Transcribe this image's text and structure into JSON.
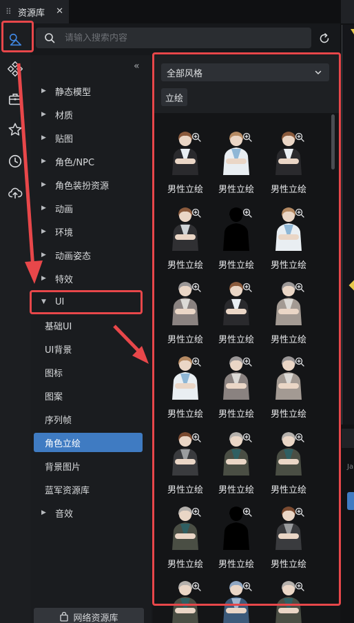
{
  "tab": {
    "title": "资源库",
    "grip": "⠿",
    "close": "✕"
  },
  "search": {
    "placeholder": "请输入搜索内容"
  },
  "rail": {
    "items": [
      "assets-icon",
      "components-icon",
      "toolbox-icon",
      "star-icon",
      "history-icon",
      "upload-icon"
    ]
  },
  "tree": {
    "collapse": "«",
    "categories": [
      {
        "label": "静态模型",
        "expanded": false
      },
      {
        "label": "材质",
        "expanded": false
      },
      {
        "label": "贴图",
        "expanded": false
      },
      {
        "label": "角色/NPC",
        "expanded": false
      },
      {
        "label": "角色装扮资源",
        "expanded": false
      },
      {
        "label": "动画",
        "expanded": false
      },
      {
        "label": "环境",
        "expanded": false
      },
      {
        "label": "动画姿态",
        "expanded": false
      },
      {
        "label": "特效",
        "expanded": false
      },
      {
        "label": "UI",
        "expanded": true
      }
    ],
    "ui_children": [
      "基础UI",
      "UI背景",
      "图标",
      "图案",
      "序列帧",
      "角色立绘",
      "背景图片",
      "蓝军资源库"
    ],
    "selected": "角色立绘",
    "after": {
      "label": "音效",
      "expanded": false
    },
    "network_button": "网络资源库"
  },
  "gallery": {
    "style_select": "全部风格",
    "tag": "立绘",
    "item_caption": "男性立绘",
    "items": [
      {
        "caption": "男性立绘",
        "hair": "#8a5a3c",
        "outfit": "#2a2a2d",
        "shirt": "#e9eef2",
        "variant": "normal"
      },
      {
        "caption": "男性立绘",
        "hair": "#b58a63",
        "outfit": "#e9eef2",
        "shirt": "#8fb7d6",
        "variant": "normal"
      },
      {
        "caption": "男性立绘",
        "hair": "#8a5a3c",
        "outfit": "#2a2a2d",
        "shirt": "#e9eef2",
        "variant": "normal"
      },
      {
        "caption": "男性立绘",
        "hair": "#8a5a3c",
        "outfit": "#303033",
        "shirt": "#cfd3d6",
        "variant": "normal"
      },
      {
        "caption": "男性立绘",
        "hair": "#000000",
        "outfit": "#000000",
        "shirt": "#000000",
        "variant": "silhouette"
      },
      {
        "caption": "男性立绘",
        "hair": "#b58a63",
        "outfit": "#e9eef2",
        "shirt": "#8fb7d6",
        "variant": "normal"
      },
      {
        "caption": "男性立绘",
        "hair": "#9a9696",
        "outfit": "#8a8280",
        "shirt": "#dcdad6",
        "variant": "normal"
      },
      {
        "caption": "男性立绘",
        "hair": "#8a5a3c",
        "outfit": "#2a2a2d",
        "shirt": "#e9eef2",
        "variant": "normal"
      },
      {
        "caption": "男性立绘",
        "hair": "#9a9696",
        "outfit": "#a39a93",
        "shirt": "#dcdad6",
        "variant": "normal"
      },
      {
        "caption": "男性立绘",
        "hair": "#b58a63",
        "outfit": "#e9eef2",
        "shirt": "#8fb7d6",
        "variant": "normal"
      },
      {
        "caption": "男性立绘",
        "hair": "#9a9696",
        "outfit": "#8a8280",
        "shirt": "#dcdad6",
        "variant": "normal"
      },
      {
        "caption": "男性立绘",
        "hair": "#9a9696",
        "outfit": "#a39a93",
        "shirt": "#dcdad6",
        "variant": "normal"
      },
      {
        "caption": "男性立绘",
        "hair": "#7a4a30",
        "outfit": "#3a3b3e",
        "shirt": "#9a9c9e",
        "variant": "normal"
      },
      {
        "caption": "男性立绘",
        "hair": "#b4b0ac",
        "outfit": "#4a4e44",
        "shirt": "#2f5f62",
        "variant": "normal"
      },
      {
        "caption": "男性立绘",
        "hair": "#b4b0ac",
        "outfit": "#4a4e44",
        "shirt": "#2f5f62",
        "variant": "normal"
      },
      {
        "caption": "男性立绘",
        "hair": "#b4b0ac",
        "outfit": "#4a4e44",
        "shirt": "#2f5f62",
        "variant": "normal"
      },
      {
        "caption": "男性立绘",
        "hair": "#000000",
        "outfit": "#000000",
        "shirt": "#000000",
        "variant": "silhouette"
      },
      {
        "caption": "男性立绘",
        "hair": "#7a4a30",
        "outfit": "#3a3b3e",
        "shirt": "#9a9c9e",
        "variant": "normal"
      },
      {
        "caption": "",
        "hair": "#b4b0ac",
        "outfit": "#4a4e44",
        "shirt": "#2f5f62",
        "variant": "normal"
      },
      {
        "caption": "",
        "hair": "#8fa6c2",
        "outfit": "#3c5a7a",
        "shirt": "#9fb6cf",
        "variant": "normal"
      },
      {
        "caption": "",
        "hair": "#b4b0ac",
        "outfit": "#4a4e44",
        "shirt": "#2f5f62",
        "variant": "normal"
      }
    ]
  },
  "right_panel": {
    "label": "Ja"
  },
  "colors": {
    "accent": "#3f7bc2",
    "annotation": "#e8474a",
    "warning": "#e6c84a"
  }
}
